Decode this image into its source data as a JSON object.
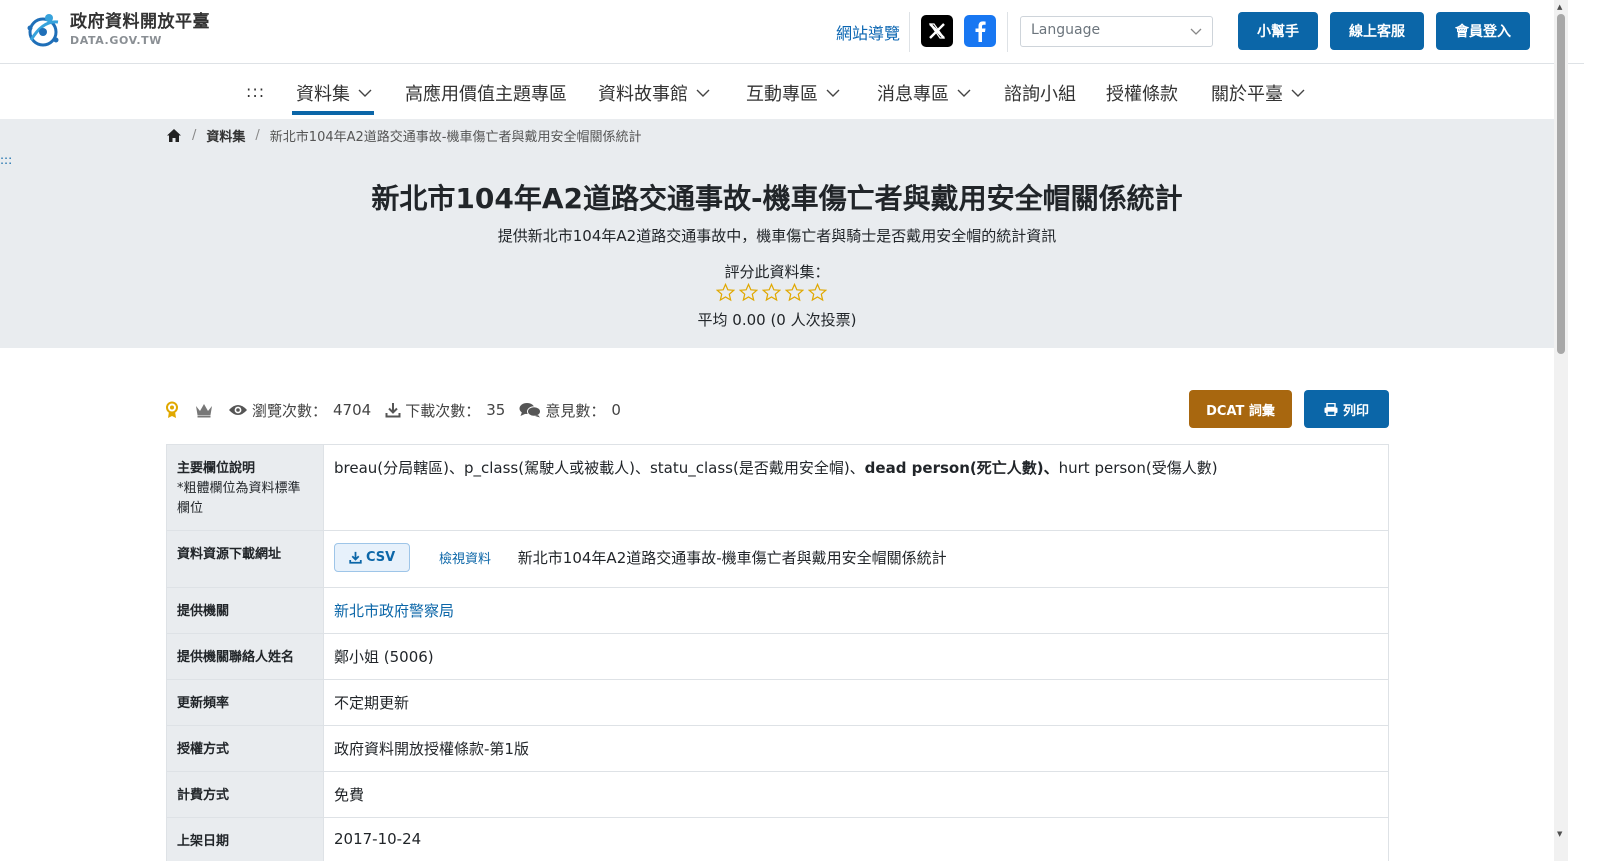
{
  "header": {
    "logo_zh": "政府資料開放平臺",
    "logo_en": "DATA.GOV.TW",
    "sitemap": "網站導覽",
    "language_placeholder": "Language",
    "helper_btn": "小幫手",
    "service_btn": "線上客服",
    "login_btn": "會員登入",
    "social_icons": [
      "x-icon",
      "facebook-icon"
    ]
  },
  "nav": {
    "dots": ":::",
    "items": [
      {
        "label": "資料集",
        "dropdown": true,
        "active": true
      },
      {
        "label": "高應用價值主題專區",
        "dropdown": false
      },
      {
        "label": "資料故事館",
        "dropdown": true
      },
      {
        "label": "互動專區",
        "dropdown": true
      },
      {
        "label": "消息專區",
        "dropdown": true
      },
      {
        "label": "諮詢小組",
        "dropdown": false
      },
      {
        "label": "授權條款",
        "dropdown": false
      },
      {
        "label": "關於平臺",
        "dropdown": true
      }
    ]
  },
  "breadcrumb": {
    "dataset": "資料集",
    "current": "新北市104年A2道路交通事故-機車傷亡者與戴用安全帽關係統計"
  },
  "hero": {
    "dots": ":::",
    "title": "新北市104年A2道路交通事故-機車傷亡者與戴用安全帽關係統計",
    "description": "提供新北市104年A2道路交通事故中，機車傷亡者與騎士是否戴用安全帽的統計資訊",
    "rate_label": "評分此資料集：",
    "rating_value": 0,
    "rating_max": 5,
    "average": "平均 0.00 (0 人次投票)"
  },
  "stats": {
    "views_label": "瀏覽次數：",
    "views": "4704",
    "downloads_label": "下載次數：",
    "downloads": "35",
    "comments_label": "意見數：",
    "comments": "0",
    "dcat_btn": "DCAT 詞彙",
    "print_btn": "列印"
  },
  "table": {
    "fields_label": "主要欄位說明",
    "fields_note": "*粗體欄位為資料標準欄位",
    "fields_part1": "breau(分局轄區)、p_class(駕駛人或被載人)、statu_class(是否戴用安全帽)、",
    "fields_bold": "dead person(死亡人數)、",
    "fields_part2": "hurt person(受傷人數)",
    "resource_label": "資料資源下載網址",
    "resource_format": "CSV",
    "resource_view": "檢視資料",
    "resource_name": "新北市104年A2道路交通事故-機車傷亡者與戴用安全帽關係統計",
    "agency_label": "提供機關",
    "agency": "新北市政府警察局",
    "contact_label": "提供機關聯絡人姓名",
    "contact": "鄭小姐 (5006)",
    "frequency_label": "更新頻率",
    "frequency": "不定期更新",
    "license_label": "授權方式",
    "license": "政府資料開放授權條款-第1版",
    "fee_label": "計費方式",
    "fee": "免費",
    "date_label": "上架日期",
    "date": "2017-10-24"
  },
  "colors": {
    "primary": "#0b66a8",
    "dcat": "#a8670f",
    "hero_bg": "#e9ecef",
    "star": "#e0a800"
  }
}
